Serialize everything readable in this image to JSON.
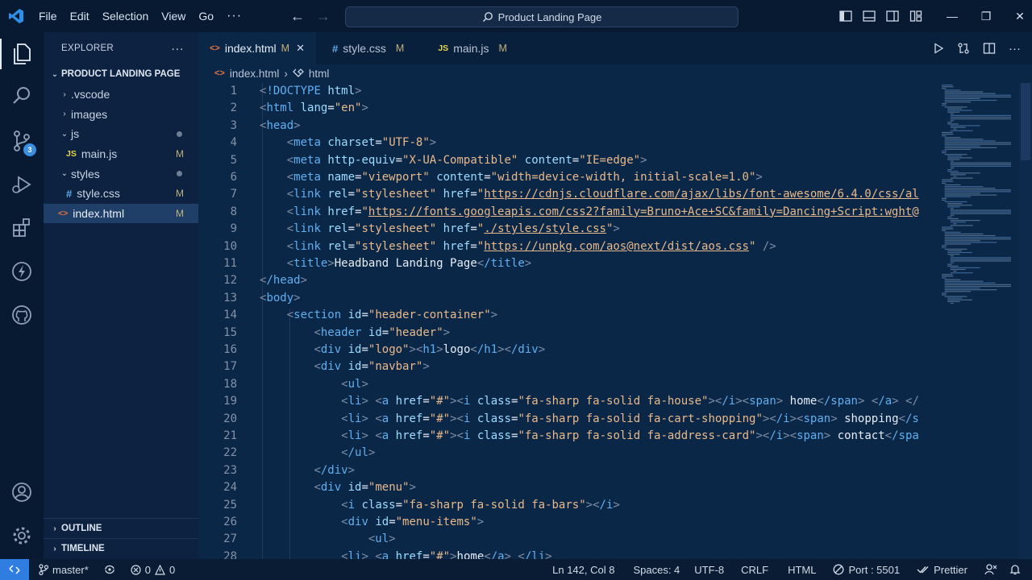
{
  "menu": {
    "items": [
      "File",
      "Edit",
      "Selection",
      "View",
      "Go"
    ],
    "more": "···"
  },
  "command_center": {
    "text": "Product Landing Page"
  },
  "window_controls": {
    "minimize": "—",
    "maximize": "❐",
    "close": "✕"
  },
  "activity_bar": {
    "source_control_badge": "3"
  },
  "sidebar": {
    "title": "EXPLORER",
    "more": "···",
    "project": "PRODUCT LANDING PAGE",
    "tree": [
      {
        "label": ".vscode",
        "type": "folder",
        "expanded": false
      },
      {
        "label": "images",
        "type": "folder",
        "expanded": false
      },
      {
        "label": "js",
        "type": "folder",
        "expanded": true
      },
      {
        "label": "main.js",
        "type": "file",
        "icon": "JS",
        "status": "M"
      },
      {
        "label": "styles",
        "type": "folder",
        "expanded": true
      },
      {
        "label": "style.css",
        "type": "file",
        "icon": "#",
        "status": "M"
      },
      {
        "label": "index.html",
        "type": "file",
        "icon": "<>",
        "status": "M"
      }
    ],
    "outline": "OUTLINE",
    "timeline": "TIMELINE"
  },
  "tabs": [
    {
      "label": "index.html",
      "icon": "<>",
      "status": "M",
      "close": "✕"
    },
    {
      "label": "style.css",
      "icon": "#",
      "status": "M"
    },
    {
      "label": "main.js",
      "icon": "JS",
      "status": "M"
    }
  ],
  "breadcrumb": {
    "file": "index.html",
    "separator": "›",
    "element": "html"
  },
  "code": {
    "line_numbers": [
      "1",
      "2",
      "3",
      "4",
      "5",
      "6",
      "7",
      "8",
      "9",
      "10",
      "11",
      "12",
      "13",
      "14",
      "15",
      "16",
      "17",
      "18",
      "19",
      "20",
      "21",
      "22",
      "23",
      "24",
      "25",
      "26",
      "27",
      "28"
    ],
    "lines": [
      "<!DOCTYPE html>",
      "<html lang=\"en\">",
      "<head>",
      "    <meta charset=\"UTF-8\">",
      "    <meta http-equiv=\"X-UA-Compatible\" content=\"IE=edge\">",
      "    <meta name=\"viewport\" content=\"width=device-width, initial-scale=1.0\">",
      "    <link rel=\"stylesheet\" href=\"https://cdnjs.cloudflare.com/ajax/libs/font-awesome/6.4.0/css/al",
      "    <link href=\"https://fonts.googleapis.com/css2?family=Bruno+Ace+SC&family=Dancing+Script:wght@",
      "    <link rel=\"stylesheet\" href=\"./styles/style.css\">",
      "    <link rel=\"stylesheet\" href=\"https://unpkg.com/aos@next/dist/aos.css\" />",
      "    <title>Headband Landing Page</title>",
      "</head>",
      "<body>",
      "    <section id=\"header-container\">",
      "        <header id=\"header\">",
      "        <div id=\"logo\"><h1>logo</h1></div>",
      "        <div id=\"navbar\">",
      "            <ul>",
      "            <li> <a href=\"#\"><i class=\"fa-sharp fa-solid fa-house\"></i><span> home</span> </a> </",
      "            <li> <a href=\"#\"><i class=\"fa-sharp fa-solid fa-cart-shopping\"></i><span> shopping</s",
      "            <li> <a href=\"#\"><i class=\"fa-sharp fa-solid fa-address-card\"></i><span> contact</spa",
      "            </ul>",
      "        </div>",
      "        <div id=\"menu\">",
      "            <i class=\"fa-sharp fa-solid fa-bars\"></i>",
      "            <div id=\"menu-items\">",
      "                <ul>",
      "            <li> <a href=\"#\">home</a> </li>"
    ]
  },
  "status_bar": {
    "branch": "master*",
    "errors": "0",
    "warnings": "0",
    "cursor": "Ln 142, Col 8",
    "spaces": "Spaces: 4",
    "encoding": "UTF-8",
    "eol": "CRLF",
    "language": "HTML",
    "port": "Port : 5501",
    "formatter": "Prettier"
  },
  "colors": {
    "titlebar": "#081a31",
    "sidebar": "#0c2240",
    "editor": "#0b2748",
    "tag": "#5fb0f0",
    "attribute": "#9cdcfe",
    "string": "#e8b98a",
    "remote_button": "#2f7de1"
  }
}
